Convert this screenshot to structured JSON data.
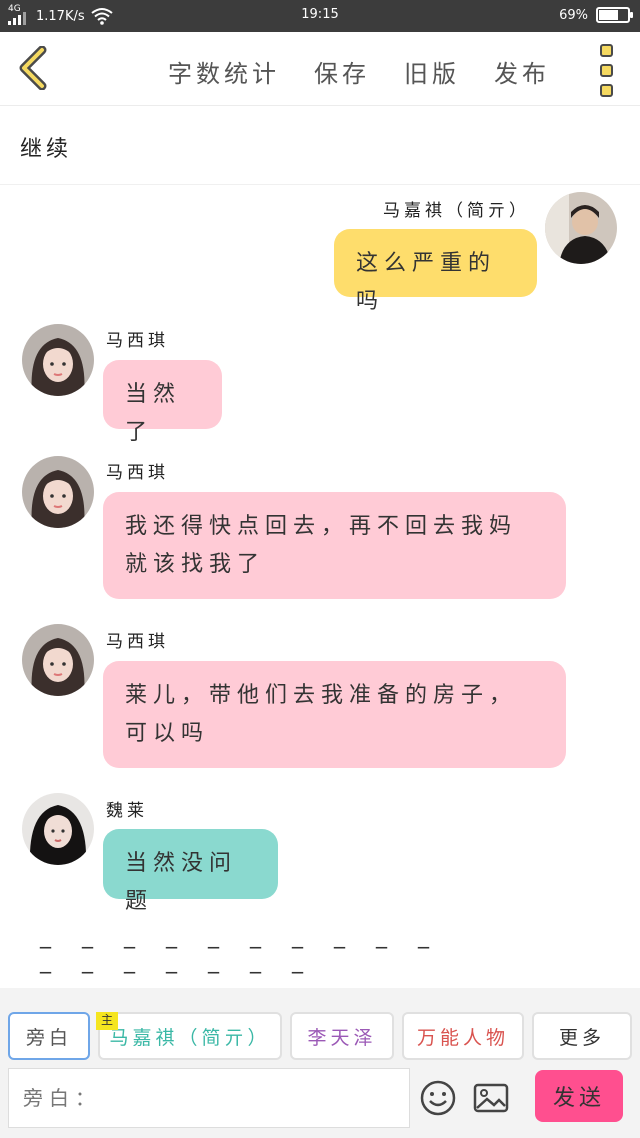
{
  "status_bar": {
    "network": "4G",
    "speed": "1.17K/s",
    "time": "19:15",
    "battery_pct": "69%",
    "battery_level": 0.69
  },
  "top_bar": {
    "back_icon": "chevron-left-icon",
    "nav": [
      "字数统计",
      "保存",
      "旧版",
      "发布"
    ],
    "menu_icon": "more-menu-icon"
  },
  "continue_label": "继续",
  "messages": [
    {
      "side": "right",
      "name": "马嘉祺（简亓）",
      "text": "这么严重的吗",
      "color": "yellow"
    },
    {
      "side": "left",
      "name": "马西琪",
      "text": "当然了",
      "color": "pink"
    },
    {
      "side": "left",
      "name": "马西琪",
      "text": "我还得快点回去，再不回去我妈就该找我了",
      "color": "pink"
    },
    {
      "side": "left",
      "name": "马西琪",
      "text": "莱儿，带他们去我准备的房子，可以吗",
      "color": "pink"
    },
    {
      "side": "left",
      "name": "魏莱",
      "text": "当然没问题",
      "color": "teal"
    }
  ],
  "divider": "_ _ _ _ _ _ _ _ _ _ _ _ _ _ _ _ _",
  "roles": [
    {
      "label": "旁白",
      "color": "#555555",
      "active": true
    },
    {
      "label": "马嘉祺（简亓）",
      "color": "#3bb8a6",
      "badge": "主"
    },
    {
      "label": "李天泽",
      "color": "#9b59b6"
    },
    {
      "label": "万能人物",
      "color": "#d9534f"
    },
    {
      "label": "更多",
      "color": "#555555"
    }
  ],
  "input": {
    "placeholder": "旁白："
  },
  "icons": {
    "emoji": "emoji-icon",
    "image": "image-icon"
  },
  "send_label": "发送",
  "colors": {
    "pink": "#ffcbd6",
    "yellow": "#fedd6c",
    "teal": "#8ad9cf",
    "send": "#ff4f8f",
    "accent": "#f5d960"
  }
}
